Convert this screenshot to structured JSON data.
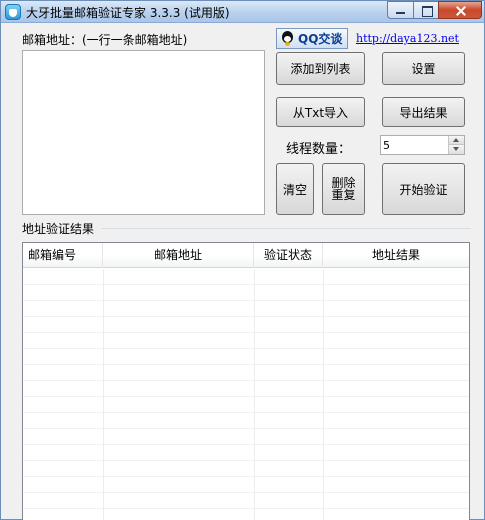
{
  "window": {
    "title": "大牙批量邮箱验证专家 3.3.3 (试用版)",
    "icons": {
      "app": "tooth-app-icon",
      "minimize": "minimize-icon",
      "maximize": "maximize-icon",
      "close": "close-icon"
    }
  },
  "input_section": {
    "label": "邮箱地址：(一行一条邮箱地址)",
    "value": ""
  },
  "links": {
    "qq_label": "QQ交谈",
    "qq_icon": "qq-penguin-icon",
    "website": "http://daya123.net"
  },
  "buttons": {
    "add_to_list": "添加到列表",
    "settings": "设置",
    "import_txt": "从Txt导入",
    "export_results": "导出结果",
    "clear": "清空",
    "remove_duplicates": "删除重复",
    "start_verify": "开始验证"
  },
  "threads": {
    "label": "线程数量：",
    "value": "5"
  },
  "results": {
    "group_label": "地址验证结果",
    "columns": [
      "邮箱编号",
      "邮箱地址",
      "验证状态",
      "地址结果"
    ],
    "rows": []
  }
}
